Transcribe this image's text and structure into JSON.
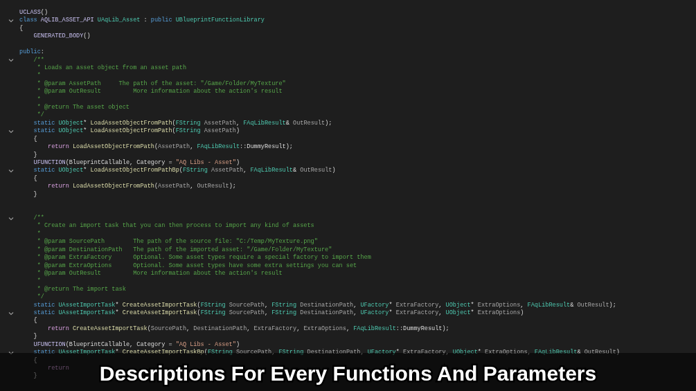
{
  "editor": {
    "lines": [
      {
        "fold": false,
        "tokens": [
          {
            "kind": "macro",
            "text": "UCLASS"
          },
          {
            "kind": "plain",
            "text": "()"
          }
        ]
      },
      {
        "fold": true,
        "tokens": [
          {
            "kind": "keyword",
            "text": "class "
          },
          {
            "kind": "macro",
            "text": "AQLIB_ASSET_API "
          },
          {
            "kind": "type",
            "text": "UAqLib_Asset"
          },
          {
            "kind": "plain",
            "text": " : "
          },
          {
            "kind": "keyword",
            "text": "public "
          },
          {
            "kind": "type",
            "text": "UBlueprintFunctionLibrary"
          }
        ]
      },
      {
        "fold": false,
        "tokens": [
          {
            "kind": "plain",
            "text": "{"
          }
        ]
      },
      {
        "fold": false,
        "tokens": [
          {
            "kind": "macro",
            "text": "    GENERATED_BODY"
          },
          {
            "kind": "plain",
            "text": "()"
          }
        ]
      },
      {
        "kind": "blank"
      },
      {
        "fold": false,
        "tokens": [
          {
            "kind": "keyword",
            "text": "public"
          },
          {
            "kind": "plain",
            "text": ":"
          }
        ]
      },
      {
        "fold": true,
        "tokens": [
          {
            "kind": "comment",
            "text": "    /**"
          }
        ]
      },
      {
        "fold": false,
        "tokens": [
          {
            "kind": "comment",
            "text": "     * Loads an asset object from an asset path"
          }
        ]
      },
      {
        "fold": false,
        "tokens": [
          {
            "kind": "comment",
            "text": "     *"
          }
        ]
      },
      {
        "fold": false,
        "tokens": [
          {
            "kind": "comment",
            "text": "     * @param AssetPath     The path of the asset: \"/Game/Folder/MyTexture\""
          }
        ]
      },
      {
        "fold": false,
        "tokens": [
          {
            "kind": "comment",
            "text": "     * @param OutResult         More information about the action's result"
          }
        ]
      },
      {
        "fold": false,
        "tokens": [
          {
            "kind": "comment",
            "text": "     *"
          }
        ]
      },
      {
        "fold": false,
        "tokens": [
          {
            "kind": "comment",
            "text": "     * @return The asset object"
          }
        ]
      },
      {
        "fold": false,
        "tokens": [
          {
            "kind": "comment",
            "text": "     */"
          }
        ]
      },
      {
        "fold": false,
        "tokens": [
          {
            "kind": "keyword",
            "text": "    static "
          },
          {
            "kind": "type",
            "text": "UObject"
          },
          {
            "kind": "plain",
            "text": "* "
          },
          {
            "kind": "function",
            "text": "LoadAssetObjectFromPath"
          },
          {
            "kind": "plain",
            "text": "("
          },
          {
            "kind": "type",
            "text": "FString"
          },
          {
            "kind": "param",
            "text": " AssetPath"
          },
          {
            "kind": "plain",
            "text": ", "
          },
          {
            "kind": "type",
            "text": "FAqLibResult"
          },
          {
            "kind": "plain",
            "text": "& "
          },
          {
            "kind": "param",
            "text": "OutResult"
          },
          {
            "kind": "plain",
            "text": ");"
          }
        ]
      },
      {
        "fold": true,
        "tokens": [
          {
            "kind": "keyword",
            "text": "    static "
          },
          {
            "kind": "type",
            "text": "UObject"
          },
          {
            "kind": "plain",
            "text": "* "
          },
          {
            "kind": "function",
            "text": "LoadAssetObjectFromPath"
          },
          {
            "kind": "plain",
            "text": "("
          },
          {
            "kind": "type",
            "text": "FString"
          },
          {
            "kind": "param",
            "text": " AssetPath"
          },
          {
            "kind": "plain",
            "text": ")"
          }
        ]
      },
      {
        "fold": false,
        "tokens": [
          {
            "kind": "plain",
            "text": "    {"
          }
        ]
      },
      {
        "fold": false,
        "tokens": [
          {
            "kind": "control",
            "text": "        return "
          },
          {
            "kind": "function",
            "text": "LoadAssetObjectFromPath"
          },
          {
            "kind": "plain",
            "text": "("
          },
          {
            "kind": "param",
            "text": "AssetPath"
          },
          {
            "kind": "plain",
            "text": ", "
          },
          {
            "kind": "type",
            "text": "FAqLibResult"
          },
          {
            "kind": "plain",
            "text": "::DummyResult);"
          }
        ]
      },
      {
        "fold": false,
        "tokens": [
          {
            "kind": "plain",
            "text": "    }"
          }
        ]
      },
      {
        "fold": false,
        "tokens": [
          {
            "kind": "macro",
            "text": "    UFUNCTION"
          },
          {
            "kind": "plain",
            "text": "(BlueprintCallable, Category = "
          },
          {
            "kind": "string",
            "text": "\"AQ Libs - Asset\""
          },
          {
            "kind": "plain",
            "text": ")"
          }
        ]
      },
      {
        "fold": true,
        "tokens": [
          {
            "kind": "keyword",
            "text": "    static "
          },
          {
            "kind": "type",
            "text": "UObject"
          },
          {
            "kind": "plain",
            "text": "* "
          },
          {
            "kind": "function",
            "text": "LoadAssetObjectFromPathBp"
          },
          {
            "kind": "plain",
            "text": "("
          },
          {
            "kind": "type",
            "text": "FString"
          },
          {
            "kind": "param",
            "text": " AssetPath"
          },
          {
            "kind": "plain",
            "text": ", "
          },
          {
            "kind": "type",
            "text": "FAqLibResult"
          },
          {
            "kind": "plain",
            "text": "& "
          },
          {
            "kind": "param",
            "text": "OutResult"
          },
          {
            "kind": "plain",
            "text": ")"
          }
        ]
      },
      {
        "fold": false,
        "tokens": [
          {
            "kind": "plain",
            "text": "    {"
          }
        ]
      },
      {
        "fold": false,
        "tokens": [
          {
            "kind": "control",
            "text": "        return "
          },
          {
            "kind": "function",
            "text": "LoadAssetObjectFromPath"
          },
          {
            "kind": "plain",
            "text": "("
          },
          {
            "kind": "param",
            "text": "AssetPath"
          },
          {
            "kind": "plain",
            "text": ", "
          },
          {
            "kind": "param",
            "text": "OutResult"
          },
          {
            "kind": "plain",
            "text": ");"
          }
        ]
      },
      {
        "fold": false,
        "tokens": [
          {
            "kind": "plain",
            "text": "    }"
          }
        ]
      },
      {
        "kind": "blank"
      },
      {
        "kind": "blank"
      },
      {
        "fold": true,
        "tokens": [
          {
            "kind": "comment",
            "text": "    /**"
          }
        ]
      },
      {
        "fold": false,
        "tokens": [
          {
            "kind": "comment",
            "text": "     * Create an import task that you can then process to import any kind of assets"
          }
        ]
      },
      {
        "fold": false,
        "tokens": [
          {
            "kind": "comment",
            "text": "     *"
          }
        ]
      },
      {
        "fold": false,
        "tokens": [
          {
            "kind": "comment",
            "text": "     * @param SourcePath        The path of the source file: \"C:/Temp/MyTexture.png\""
          }
        ]
      },
      {
        "fold": false,
        "tokens": [
          {
            "kind": "comment",
            "text": "     * @param DestinationPath   The path of the imported asset: \"/Game/Folder/MyTexture\""
          }
        ]
      },
      {
        "fold": false,
        "tokens": [
          {
            "kind": "comment",
            "text": "     * @param ExtraFactory      Optional. Some asset types require a special factory to import them"
          }
        ]
      },
      {
        "fold": false,
        "tokens": [
          {
            "kind": "comment",
            "text": "     * @param ExtraOptions      Optional. Some asset types have some extra settings you can set"
          }
        ]
      },
      {
        "fold": false,
        "tokens": [
          {
            "kind": "comment",
            "text": "     * @param OutResult         More information about the action's result"
          }
        ]
      },
      {
        "fold": false,
        "tokens": [
          {
            "kind": "comment",
            "text": "     *"
          }
        ]
      },
      {
        "fold": false,
        "tokens": [
          {
            "kind": "comment",
            "text": "     * @return The import task"
          }
        ]
      },
      {
        "fold": false,
        "tokens": [
          {
            "kind": "comment",
            "text": "     */"
          }
        ]
      },
      {
        "fold": false,
        "tokens": [
          {
            "kind": "keyword",
            "text": "    static "
          },
          {
            "kind": "type",
            "text": "UAssetImportTask"
          },
          {
            "kind": "plain",
            "text": "* "
          },
          {
            "kind": "function",
            "text": "CreateAssetImportTask"
          },
          {
            "kind": "plain",
            "text": "("
          },
          {
            "kind": "type",
            "text": "FString"
          },
          {
            "kind": "param",
            "text": " SourcePath"
          },
          {
            "kind": "plain",
            "text": ", "
          },
          {
            "kind": "type",
            "text": "FString"
          },
          {
            "kind": "param",
            "text": " DestinationPath"
          },
          {
            "kind": "plain",
            "text": ", "
          },
          {
            "kind": "type",
            "text": "UFactory"
          },
          {
            "kind": "plain",
            "text": "* "
          },
          {
            "kind": "param",
            "text": "ExtraFactory"
          },
          {
            "kind": "plain",
            "text": ", "
          },
          {
            "kind": "type",
            "text": "UObject"
          },
          {
            "kind": "plain",
            "text": "* "
          },
          {
            "kind": "param",
            "text": "ExtraOptions"
          },
          {
            "kind": "plain",
            "text": ", "
          },
          {
            "kind": "type",
            "text": "FAqLibResult"
          },
          {
            "kind": "plain",
            "text": "& "
          },
          {
            "kind": "param",
            "text": "OutResult"
          },
          {
            "kind": "plain",
            "text": ");"
          }
        ]
      },
      {
        "fold": true,
        "tokens": [
          {
            "kind": "keyword",
            "text": "    static "
          },
          {
            "kind": "type",
            "text": "UAssetImportTask"
          },
          {
            "kind": "plain",
            "text": "* "
          },
          {
            "kind": "function",
            "text": "CreateAssetImportTask"
          },
          {
            "kind": "plain",
            "text": "("
          },
          {
            "kind": "type",
            "text": "FString"
          },
          {
            "kind": "param",
            "text": " SourcePath"
          },
          {
            "kind": "plain",
            "text": ", "
          },
          {
            "kind": "type",
            "text": "FString"
          },
          {
            "kind": "param",
            "text": " DestinationPath"
          },
          {
            "kind": "plain",
            "text": ", "
          },
          {
            "kind": "type",
            "text": "UFactory"
          },
          {
            "kind": "plain",
            "text": "* "
          },
          {
            "kind": "param",
            "text": "ExtraFactory"
          },
          {
            "kind": "plain",
            "text": ", "
          },
          {
            "kind": "type",
            "text": "UObject"
          },
          {
            "kind": "plain",
            "text": "* "
          },
          {
            "kind": "param",
            "text": "ExtraOptions"
          },
          {
            "kind": "plain",
            "text": ")"
          }
        ]
      },
      {
        "fold": false,
        "tokens": [
          {
            "kind": "plain",
            "text": "    {"
          }
        ]
      },
      {
        "fold": false,
        "tokens": [
          {
            "kind": "control",
            "text": "        return "
          },
          {
            "kind": "function",
            "text": "CreateAssetImportTask"
          },
          {
            "kind": "plain",
            "text": "("
          },
          {
            "kind": "param",
            "text": "SourcePath"
          },
          {
            "kind": "plain",
            "text": ", "
          },
          {
            "kind": "param",
            "text": "DestinationPath"
          },
          {
            "kind": "plain",
            "text": ", "
          },
          {
            "kind": "param",
            "text": "ExtraFactory"
          },
          {
            "kind": "plain",
            "text": ", "
          },
          {
            "kind": "param",
            "text": "ExtraOptions"
          },
          {
            "kind": "plain",
            "text": ", "
          },
          {
            "kind": "type",
            "text": "FAqLibResult"
          },
          {
            "kind": "plain",
            "text": "::DummyResult);"
          }
        ]
      },
      {
        "fold": false,
        "tokens": [
          {
            "kind": "plain",
            "text": "    }"
          }
        ]
      },
      {
        "fold": false,
        "tokens": [
          {
            "kind": "macro",
            "text": "    UFUNCTION"
          },
          {
            "kind": "plain",
            "text": "(BlueprintCallable, Category = "
          },
          {
            "kind": "string",
            "text": "\"AQ Libs - Asset\""
          },
          {
            "kind": "plain",
            "text": ")"
          }
        ]
      },
      {
        "fold": true,
        "tokens": [
          {
            "kind": "keyword",
            "text": "    static "
          },
          {
            "kind": "type",
            "text": "UAssetImportTask"
          },
          {
            "kind": "plain",
            "text": "* "
          },
          {
            "kind": "function",
            "text": "CreateAssetImportTaskBp"
          },
          {
            "kind": "plain",
            "text": "("
          },
          {
            "kind": "type",
            "text": "FString"
          },
          {
            "kind": "param",
            "text": " SourcePath"
          },
          {
            "kind": "plain",
            "text": ", "
          },
          {
            "kind": "type",
            "text": "FString"
          },
          {
            "kind": "param",
            "text": " DestinationPath"
          },
          {
            "kind": "plain",
            "text": ", "
          },
          {
            "kind": "type",
            "text": "UFactory"
          },
          {
            "kind": "plain",
            "text": "* "
          },
          {
            "kind": "param",
            "text": "ExtraFactory"
          },
          {
            "kind": "plain",
            "text": ", "
          },
          {
            "kind": "type",
            "text": "UObject"
          },
          {
            "kind": "plain",
            "text": "* "
          },
          {
            "kind": "param",
            "text": "ExtraOptions"
          },
          {
            "kind": "plain",
            "text": ", "
          },
          {
            "kind": "type",
            "text": "FAqLibResult"
          },
          {
            "kind": "plain",
            "text": "& "
          },
          {
            "kind": "param",
            "text": "OutResult"
          },
          {
            "kind": "plain",
            "text": ")"
          }
        ]
      },
      {
        "fold": false,
        "tokens": [
          {
            "kind": "plain",
            "text": "    {"
          }
        ]
      },
      {
        "fold": false,
        "tokens": [
          {
            "kind": "control",
            "text": "        return"
          }
        ]
      },
      {
        "fold": false,
        "tokens": [
          {
            "kind": "plain",
            "text": "    }"
          }
        ]
      }
    ]
  },
  "caption": "Descriptions For Every Functions And Parameters"
}
